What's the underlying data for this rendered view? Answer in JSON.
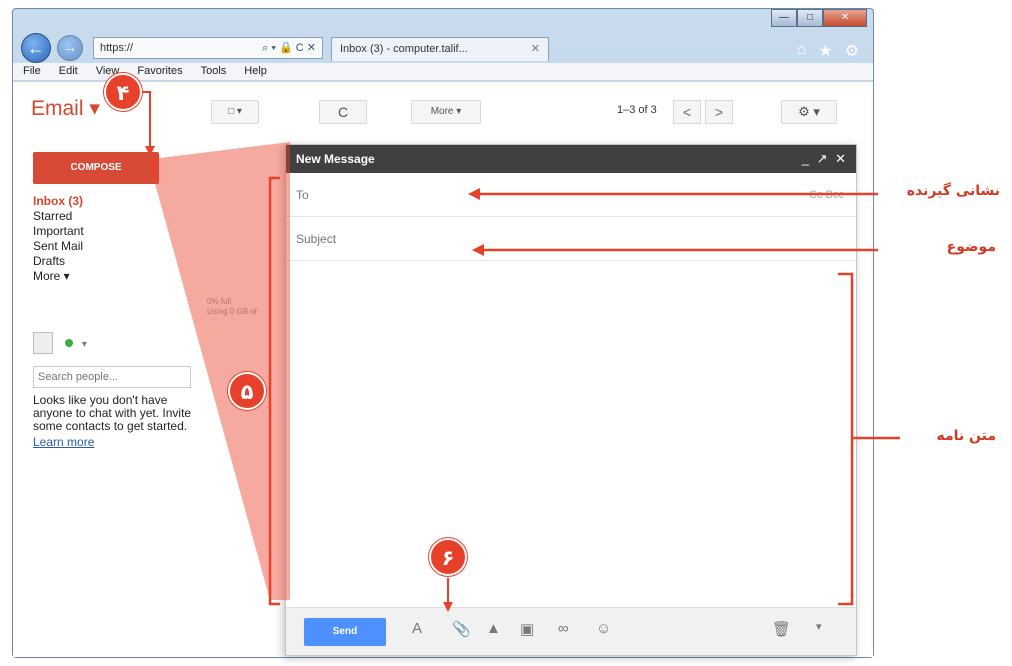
{
  "browser": {
    "address": "https://",
    "address_tools": "⌕ ▾ 🔒 C ✕",
    "tab_title": "Inbox (3) - computer.talif...",
    "tab_close": "✕",
    "window_controls": [
      "—",
      "□",
      "✕"
    ],
    "menu": [
      "File",
      "Edit",
      "View",
      "Favorites",
      "Tools",
      "Help"
    ]
  },
  "gmail": {
    "logo": "Email ▾",
    "toolbar": {
      "select": "□ ▾",
      "refresh": "C",
      "more": "More ▾",
      "count": "1–3 of 3",
      "prev": "<",
      "next": ">",
      "settings": "⚙ ▾"
    },
    "compose_label": "COMPOSE",
    "folders": [
      "Inbox (3)",
      "Starred",
      "Important",
      "Sent Mail",
      "Drafts",
      "More ▾"
    ],
    "search_people_placeholder": "Search people...",
    "chat_message": "Looks like you don't have anyone to chat with yet. Invite some contacts to get started.",
    "learn_more": "Learn more",
    "storage_line1": "0% full",
    "storage_line2": "Using 0 GB of"
  },
  "compose": {
    "title": "New Message",
    "controls": "_ ↗ ✕",
    "to_placeholder": "To",
    "cc_bcc": "Cc  Bcc",
    "subject_placeholder": "Subject",
    "send_label": "Send"
  },
  "annotations": {
    "markers": [
      "۴",
      "۵",
      "۶"
    ],
    "labels": {
      "recipient": "نشانی گیرنده",
      "subject": "موضوع",
      "body": "متن نامه"
    },
    "accent_color": "#e8412b"
  }
}
